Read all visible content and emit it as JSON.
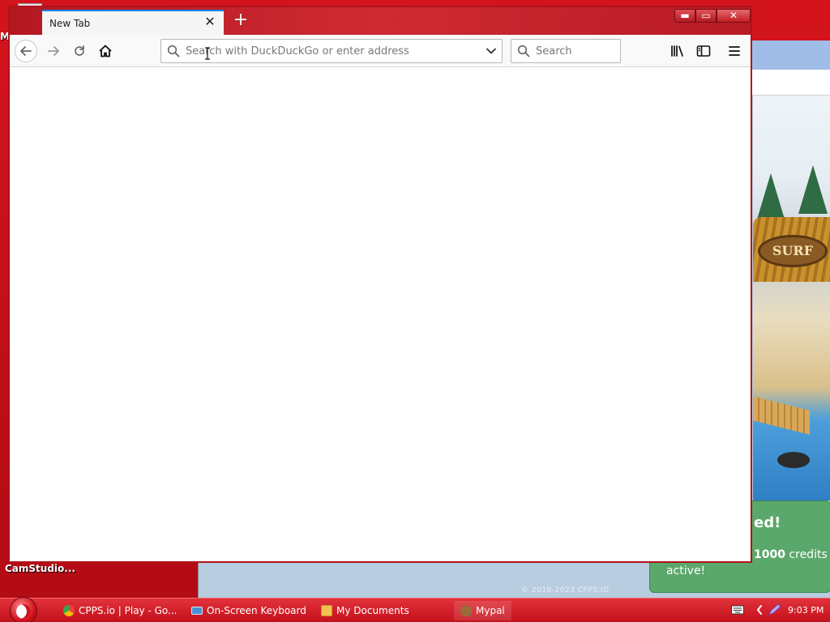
{
  "desktop": {
    "icon_label": "CamStudio...",
    "partial_letter": "M"
  },
  "background_window": {
    "scene_sign": "SURF",
    "notice_title": "ed!",
    "notice_credits_number": "1000",
    "notice_credits_text": "credits fo",
    "notice_active": "active!",
    "copyright": "© 2018-2023 CPPS.IO"
  },
  "browser": {
    "tab_title": "New Tab",
    "new_tab_symbol": "+",
    "close_tab_symbol": "✕",
    "window_buttons": {
      "minimize": "▬",
      "maximize": "▭",
      "close": "✕"
    },
    "address_bar": {
      "placeholder": "Search with DuckDuckGo or enter address",
      "value": ""
    },
    "search_box": {
      "placeholder": "Search",
      "value": ""
    }
  },
  "taskbar": {
    "items": [
      {
        "label": "CPPS.io | Play - Go...",
        "icon": "chrome-icon",
        "color": "#4caf50"
      },
      {
        "label": "On-Screen Keyboard",
        "icon": "keyboard-icon",
        "color": "#4a90d9"
      },
      {
        "label": "My Documents",
        "icon": "folder-icon",
        "color": "#f2c14e"
      },
      {
        "label": "Mypal",
        "icon": "mypal-icon",
        "color": "#9b6b3a"
      }
    ],
    "clock": "9:03 PM"
  },
  "colors": {
    "desktop_red": "#c8101a",
    "titlebar_red": "#cf2a33",
    "tab_accent": "#0a84ff",
    "notice_green": "#5aa86b"
  }
}
